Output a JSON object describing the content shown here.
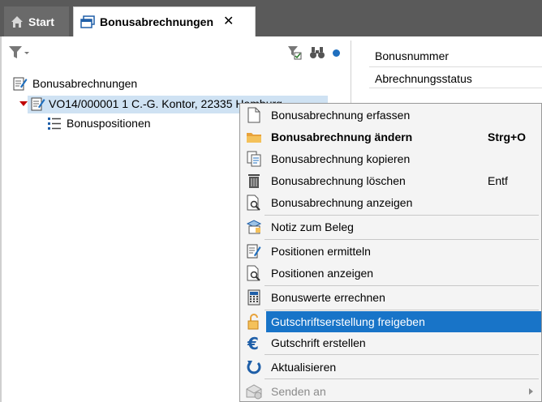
{
  "tabs": {
    "start_label": "Start",
    "active_label": "Bonusabrechnungen"
  },
  "tree": {
    "root_label": "Bonusabrechnungen",
    "node_label": "VO14/000001  1  C.-G. Kontor, 22335 Hamburg",
    "child_label": "Bonuspositionen"
  },
  "detail": {
    "field1": "Bonusnummer",
    "field2": "Abrechnungsstatus"
  },
  "menu": {
    "items": [
      {
        "label": "Bonusabrechnung erfassen",
        "shortcut": ""
      },
      {
        "label": "Bonusabrechnung ändern",
        "shortcut": "Strg+O"
      },
      {
        "label": "Bonusabrechnung kopieren",
        "shortcut": ""
      },
      {
        "label": "Bonusabrechnung löschen",
        "shortcut": "Entf"
      },
      {
        "label": "Bonusabrechnung anzeigen",
        "shortcut": ""
      },
      {
        "label": "Notiz zum Beleg",
        "shortcut": ""
      },
      {
        "label": "Positionen ermitteln",
        "shortcut": ""
      },
      {
        "label": "Positionen anzeigen",
        "shortcut": ""
      },
      {
        "label": "Bonuswerte errechnen",
        "shortcut": ""
      },
      {
        "label": "Gutschriftserstellung freigeben",
        "shortcut": ""
      },
      {
        "label": "Gutschrift erstellen",
        "shortcut": ""
      },
      {
        "label": "Aktualisieren",
        "shortcut": ""
      },
      {
        "label": "Senden an",
        "shortcut": ""
      }
    ]
  },
  "colors": {
    "highlight": "#1874c8",
    "selection": "#cfe2f3",
    "tabbar": "#5a5a5a"
  }
}
